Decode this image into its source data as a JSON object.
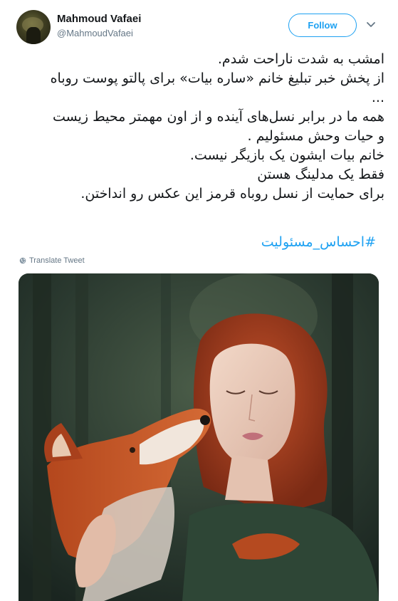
{
  "author": {
    "name": "Mahmoud Vafaei",
    "handle": "@MahmoudVafaei",
    "avatar_icon": "avatar-photo"
  },
  "actions": {
    "follow_label": "Follow",
    "menu_icon": "chevron-down-icon"
  },
  "tweet": {
    "lines": [
      "امشب به شدت ناراحت شدم.",
      "از پخش خبر تبلیغ خانم «ساره بیات» برای پالتو پوست روباه",
      "...",
      "همه ما در برابر نسل‌های آینده و از اون مهمتر محیط زیست",
      "و حیات وحش مسئولیم .",
      "خانم بیات ایشون یک بازیگر نیست.",
      "فقط یک مدلینگ هستن",
      "برای حمایت از نسل روباه قرمز این عکس رو انداختن."
    ],
    "hashtag": "#احساس_مسئولیت",
    "translate_label": "Translate Tweet"
  },
  "media": {
    "description_icon": "tweet-photo"
  },
  "colors": {
    "accent": "#1da1f2",
    "text": "#14171a",
    "muted": "#657786"
  }
}
